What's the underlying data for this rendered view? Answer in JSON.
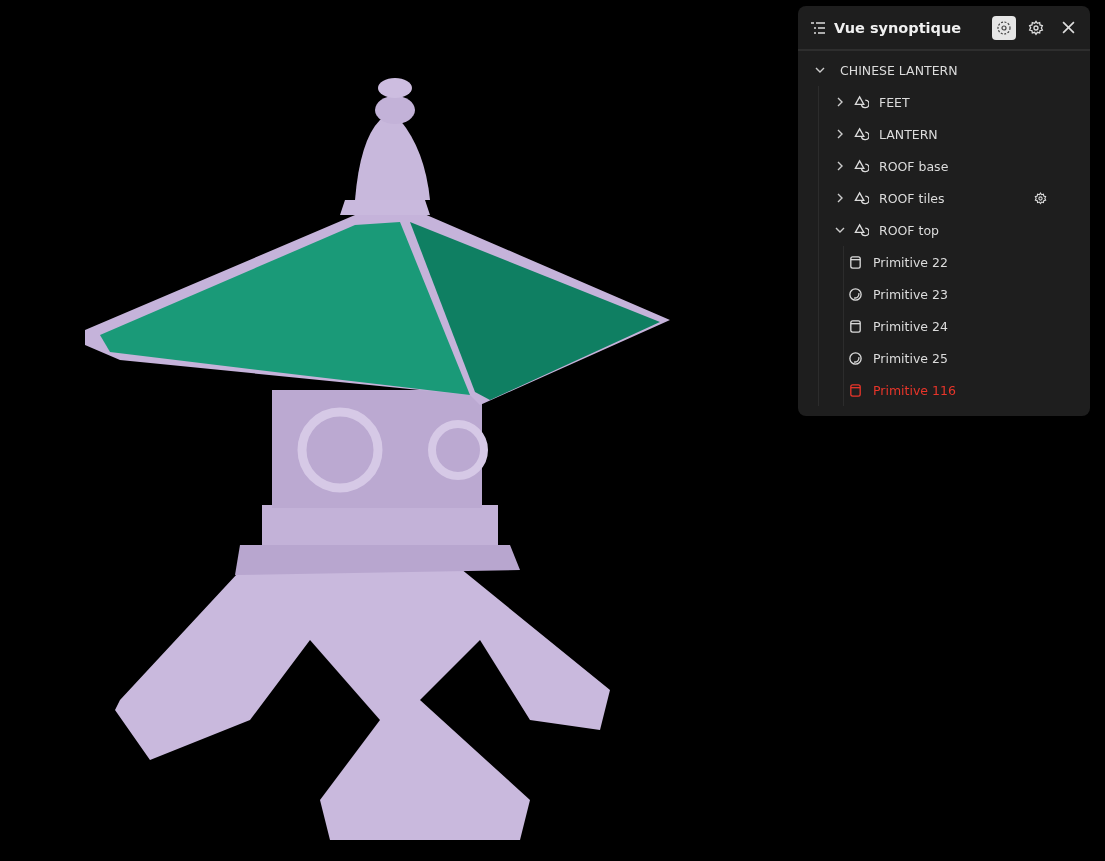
{
  "panel": {
    "title": "Vue synoptique"
  },
  "tree": [
    {
      "label": "CHINESE LANTERN",
      "kind": "root",
      "expanded": true,
      "children": [
        {
          "label": "FEET",
          "kind": "group",
          "expanded": false
        },
        {
          "label": "LANTERN",
          "kind": "group",
          "expanded": false
        },
        {
          "label": "ROOF base",
          "kind": "group",
          "expanded": false
        },
        {
          "label": "ROOF tiles",
          "kind": "group",
          "expanded": false,
          "has_settings": true
        },
        {
          "label": "ROOF top",
          "kind": "group",
          "expanded": true,
          "children": [
            {
              "label": "Primitive 22",
              "kind": "cylinder",
              "selected": false
            },
            {
              "label": "Primitive 23",
              "kind": "sphere",
              "selected": false
            },
            {
              "label": "Primitive 24",
              "kind": "cylinder",
              "selected": false
            },
            {
              "label": "Primitive 25",
              "kind": "sphere",
              "selected": false
            },
            {
              "label": "Primitive 116",
              "kind": "cylinder",
              "selected": true
            }
          ]
        }
      ]
    }
  ]
}
